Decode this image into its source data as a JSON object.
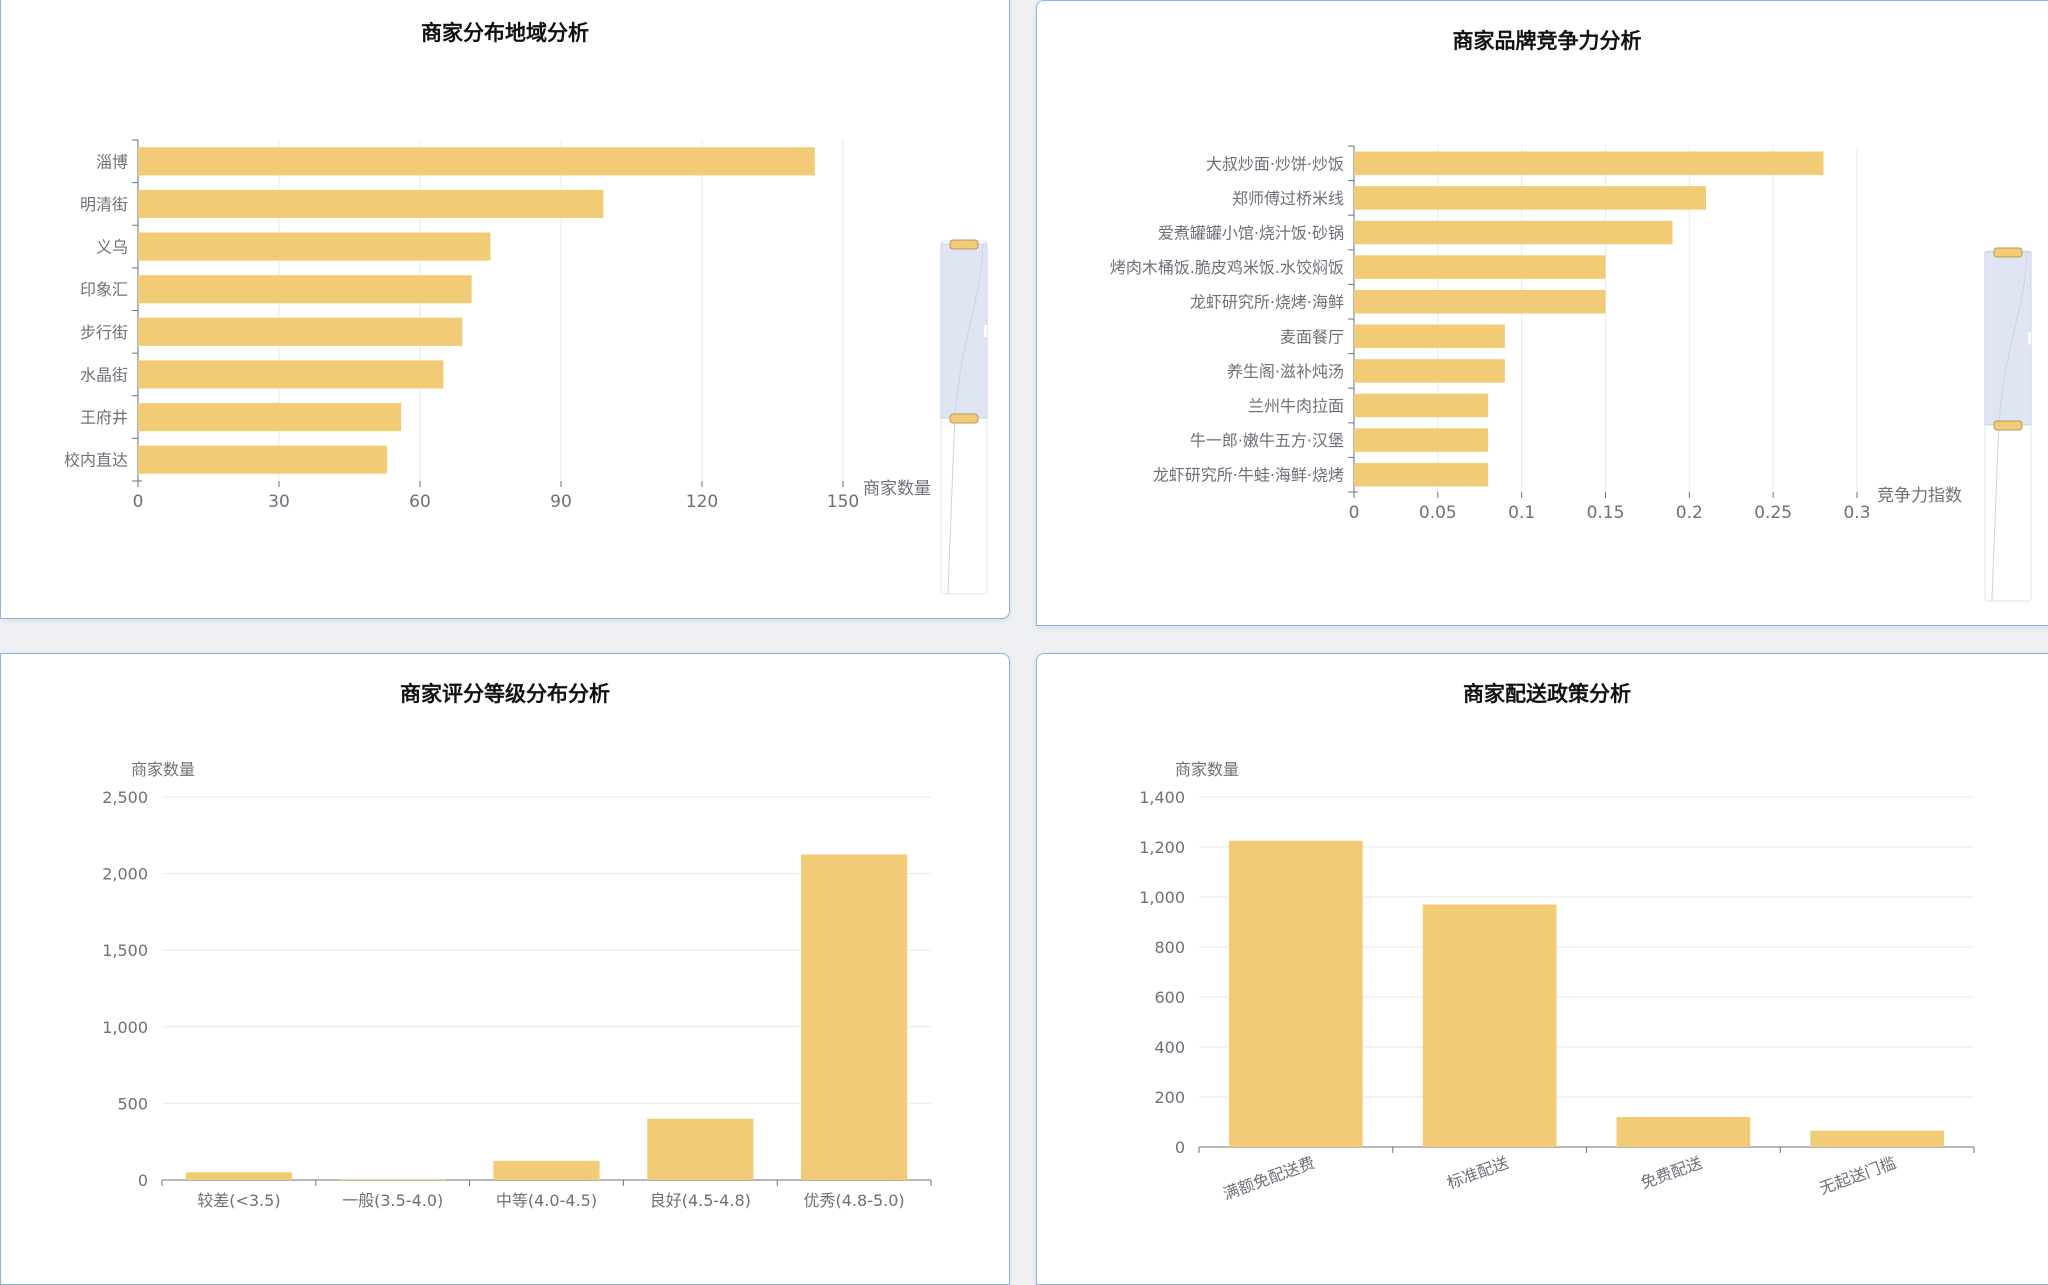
{
  "colors": {
    "bar": "#f2cb76",
    "axis": "#6e7079",
    "grid": "#e8eaef",
    "label": "#6e7079",
    "zoom_fill": "#dfe5f2",
    "zoom_handle": "#f2cb76"
  },
  "chart_data": [
    {
      "type": "bar",
      "orientation": "horizontal",
      "title": "商家分布地域分析",
      "categories": [
        "淄博",
        "明清街",
        "义乌",
        "印象汇",
        "步行街",
        "水晶街",
        "王府井",
        "校内直达"
      ],
      "values": [
        144,
        99,
        75,
        71,
        69,
        65,
        56,
        53
      ],
      "xlabel": "商家数量",
      "xlim": [
        0,
        150
      ],
      "xticks": [
        "0",
        "30",
        "60",
        "90",
        "120",
        "150"
      ],
      "grid": true,
      "datazoom": "vertical-slider-right"
    },
    {
      "type": "bar",
      "orientation": "horizontal",
      "title": "商家品牌竞争力分析",
      "categories": [
        "大叔炒面·炒饼·炒饭",
        "郑师傅过桥米线",
        "爱煮罐罐小馆·烧汁饭·砂锅",
        "烤肉木桶饭.脆皮鸡米饭.水饺焖饭",
        "龙虾研究所·烧烤·海鲜",
        "麦面餐厅",
        "养生阁·滋补炖汤",
        "兰州牛肉拉面",
        "牛一郎·嫩牛五方·汉堡",
        "龙虾研究所·牛蛙·海鲜·烧烤"
      ],
      "values": [
        0.28,
        0.21,
        0.19,
        0.15,
        0.15,
        0.09,
        0.09,
        0.08,
        0.08,
        0.08
      ],
      "xlabel": "竞争力指数",
      "xlim": [
        0,
        0.3
      ],
      "xticks": [
        "0",
        "0.05",
        "0.1",
        "0.15",
        "0.2",
        "0.25",
        "0.3"
      ],
      "grid": true,
      "datazoom": "vertical-slider-right"
    },
    {
      "type": "bar",
      "orientation": "vertical",
      "title": "商家评分等级分布分析",
      "categories": [
        "较差(<3.5)",
        "一般(3.5-4.0)",
        "中等(4.0-4.5)",
        "良好(4.5-4.8)",
        "优秀(4.8-5.0)"
      ],
      "values": [
        50,
        5,
        125,
        400,
        2125
      ],
      "ylabel": "商家数量",
      "ylim": [
        0,
        2500
      ],
      "yticks": [
        "0",
        "500",
        "1,000",
        "1,500",
        "2,000",
        "2,500"
      ],
      "grid": true
    },
    {
      "type": "bar",
      "orientation": "vertical",
      "title": "商家配送政策分析",
      "categories": [
        "满额免配送费",
        "标准配送",
        "免费配送",
        "无起送门槛"
      ],
      "values": [
        1225,
        970,
        120,
        65
      ],
      "ylabel": "商家数量",
      "ylim": [
        0,
        1400
      ],
      "yticks": [
        "0",
        "200",
        "400",
        "600",
        "800",
        "1,000",
        "1,200",
        "1,400"
      ],
      "grid": true,
      "rotated_category_labels": true
    }
  ]
}
